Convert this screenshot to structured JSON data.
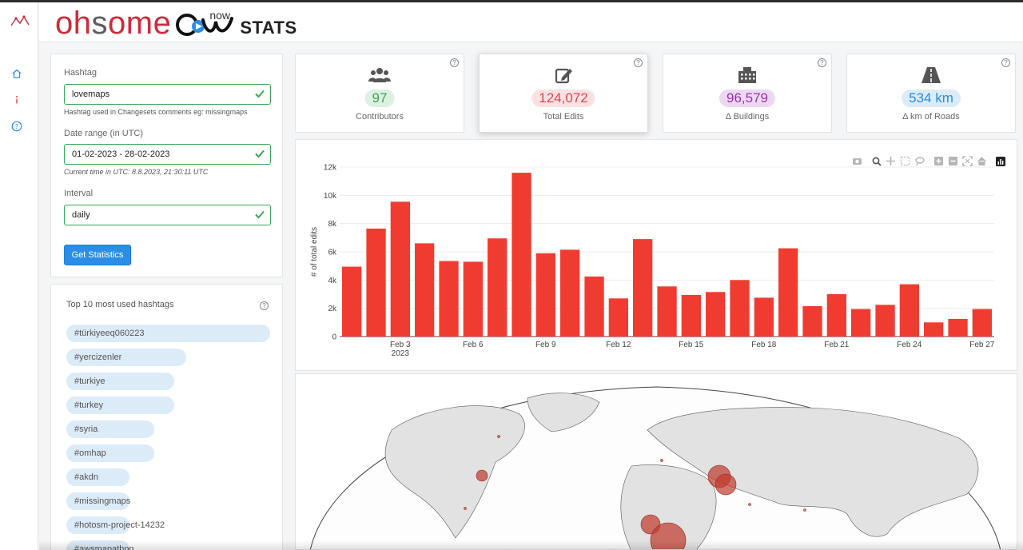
{
  "brand": {
    "part1": "oh",
    "part2": "s",
    "part3": "ome",
    "now": "now",
    "stats": "STATS"
  },
  "nav": {
    "items": [
      "home-icon",
      "info-icon",
      "help-icon"
    ]
  },
  "form": {
    "hashtag_label": "Hashtag",
    "hashtag_value": "lovemaps",
    "hashtag_hint": "Hashtag used in Changesets comments eg: missingmaps",
    "date_label": "Date range (in UTC)",
    "date_value": "01-02-2023 - 28-02-2023",
    "time_hint": "Current time in UTC: 8.8.2023, 21:30:11 UTC",
    "interval_label": "Interval",
    "interval_value": "daily",
    "submit_label": "Get Statistics"
  },
  "hashtags": {
    "title": "Top 10 most used hashtags",
    "items": [
      {
        "tag": "#türkiyeeq060223",
        "share": 1.0
      },
      {
        "tag": "#yercizenler",
        "share": 0.59
      },
      {
        "tag": "#turkiye",
        "share": 0.53
      },
      {
        "tag": "#turkey",
        "share": 0.53
      },
      {
        "tag": "#syria",
        "share": 0.43
      },
      {
        "tag": "#omhap",
        "share": 0.43
      },
      {
        "tag": "#akdn",
        "share": 0.31
      },
      {
        "tag": "#missingmaps",
        "share": 0.31
      },
      {
        "tag": "#hotosm-project-14232",
        "share": 0.31
      },
      {
        "tag": "#awsmapathon",
        "share": 0.31
      }
    ]
  },
  "kpis": [
    {
      "value": "97",
      "label": "Contributors",
      "icon": "users-icon",
      "color": "#3aa655",
      "bg": "#dcf1e1"
    },
    {
      "value": "124,072",
      "label": "Total Edits",
      "icon": "edit-icon",
      "color": "#e0454c",
      "bg": "#fce1e2"
    },
    {
      "value": "96,579",
      "label": "Δ Buildings",
      "icon": "building-icon",
      "color": "#9b2fae",
      "bg": "#ecd9f1"
    },
    {
      "value": "534 km",
      "label": "Δ km of Roads",
      "icon": "road-icon",
      "color": "#2a8ee6",
      "bg": "#dcebf8"
    }
  ],
  "colors": {
    "bar": "#f03c30",
    "accent": "#2a8ee6",
    "valid": "#3aa655"
  },
  "chart_data": {
    "type": "bar",
    "ylabel": "# of total edits",
    "xlabel": "",
    "ylim": [
      0,
      12000
    ],
    "yticks": [
      0,
      2000,
      4000,
      6000,
      8000,
      10000,
      12000
    ],
    "ytick_labels": [
      "0",
      "2k",
      "4k",
      "6k",
      "8k",
      "10k",
      "12k"
    ],
    "x": [
      "2023-02-01",
      "2023-02-02",
      "2023-02-03",
      "2023-02-04",
      "2023-02-05",
      "2023-02-06",
      "2023-02-07",
      "2023-02-08",
      "2023-02-09",
      "2023-02-10",
      "2023-02-11",
      "2023-02-12",
      "2023-02-13",
      "2023-02-14",
      "2023-02-15",
      "2023-02-16",
      "2023-02-17",
      "2023-02-18",
      "2023-02-19",
      "2023-02-20",
      "2023-02-21",
      "2023-02-22",
      "2023-02-23",
      "2023-02-24",
      "2023-02-25",
      "2023-02-26",
      "2023-02-27"
    ],
    "values": [
      4950,
      7650,
      9550,
      6600,
      5350,
      5300,
      6950,
      11600,
      5900,
      6150,
      4250,
      2700,
      6900,
      3550,
      2950,
      3150,
      4000,
      2750,
      6250,
      2150,
      3000,
      1950,
      2250,
      3700,
      1000,
      1250,
      1950
    ],
    "xtick_labels": [
      {
        "label": "Feb 3",
        "sub": "2023",
        "at": 2
      },
      {
        "label": "Feb 6",
        "sub": "",
        "at": 5
      },
      {
        "label": "Feb 9",
        "sub": "",
        "at": 8
      },
      {
        "label": "Feb 12",
        "sub": "",
        "at": 11
      },
      {
        "label": "Feb 15",
        "sub": "",
        "at": 14
      },
      {
        "label": "Feb 18",
        "sub": "",
        "at": 17
      },
      {
        "label": "Feb 21",
        "sub": "",
        "at": 20
      },
      {
        "label": "Feb 24",
        "sub": "",
        "at": 23
      },
      {
        "label": "Feb 27",
        "sub": "",
        "at": 26
      }
    ],
    "grid": true
  },
  "modebar": [
    "camera-icon",
    "zoom-icon",
    "pan-icon",
    "box-select-icon",
    "lasso-icon",
    "zoom-in-icon",
    "zoom-out-icon",
    "autoscale-icon",
    "reset-icon",
    "plotly-icon"
  ]
}
